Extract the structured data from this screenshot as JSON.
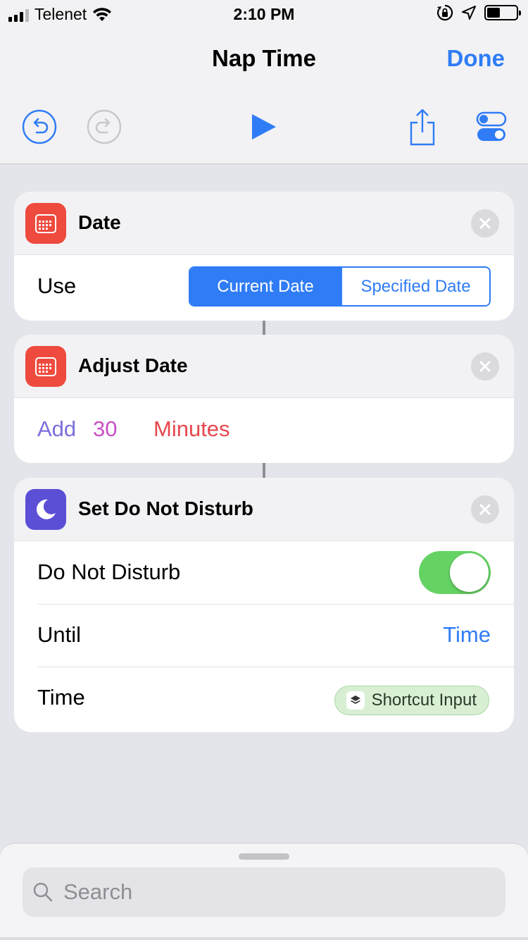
{
  "status": {
    "carrier": "Telenet",
    "time": "2:10 PM"
  },
  "nav": {
    "title": "Nap Time",
    "done_label": "Done"
  },
  "actions": [
    {
      "title": "Date",
      "icon": "calendar-icon",
      "color": "#ee4b3e",
      "use_label": "Use",
      "segments": [
        "Current Date",
        "Specified Date"
      ],
      "selected_segment": "Current Date"
    },
    {
      "title": "Adjust Date",
      "icon": "calendar-icon",
      "color": "#ee4b3e",
      "operation": "Add",
      "amount": "30",
      "unit": "Minutes"
    },
    {
      "title": "Set Do Not Disturb",
      "icon": "moon-icon",
      "color": "#5b4fd6",
      "rows": {
        "dnd_label": "Do Not Disturb",
        "dnd_on": true,
        "until_label": "Until",
        "until_value": "Time",
        "time_label": "Time",
        "time_token": "Shortcut Input"
      }
    }
  ],
  "colors": {
    "accent": "#2f7cf6",
    "operation": "#7b6fdb",
    "amount": "#c74fc5",
    "unit": "#e5484d",
    "toggle_on": "#65d264"
  },
  "search": {
    "placeholder": "Search"
  }
}
